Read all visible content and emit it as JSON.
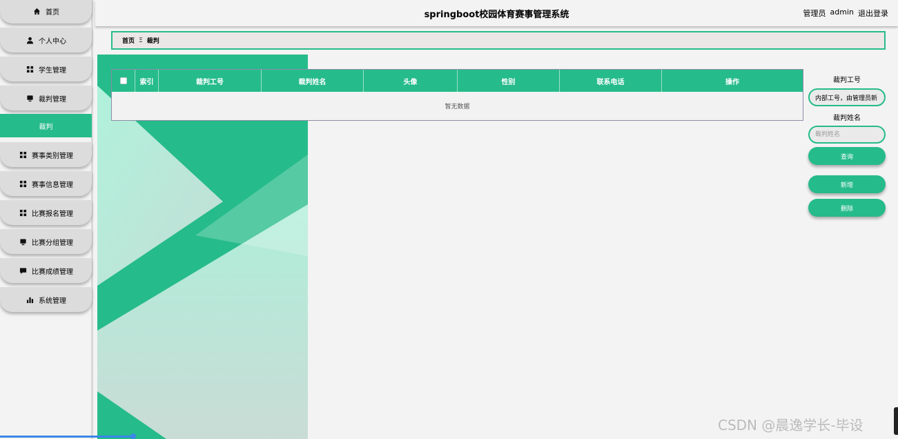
{
  "header": {
    "title": "springboot校园体育赛事管理系统",
    "role": "管理员",
    "username": "admin",
    "logout": "退出登录"
  },
  "sidebar": {
    "items": [
      {
        "label": "首页",
        "icon": "home-icon"
      },
      {
        "label": "个人中心",
        "icon": "user-icon"
      },
      {
        "label": "学生管理",
        "icon": "grid-icon"
      },
      {
        "label": "裁判管理",
        "icon": "monitor-icon"
      },
      {
        "label": "裁判",
        "icon": "",
        "active": true
      },
      {
        "label": "赛事类别管理",
        "icon": "grid-icon"
      },
      {
        "label": "赛事信息管理",
        "icon": "grid-icon"
      },
      {
        "label": "比赛报名管理",
        "icon": "grid-icon"
      },
      {
        "label": "比赛分组管理",
        "icon": "monitor-icon"
      },
      {
        "label": "比赛成绩管理",
        "icon": "message-icon"
      },
      {
        "label": "系统管理",
        "icon": "bar-chart-icon"
      }
    ]
  },
  "breadcrumb": {
    "home": "首页",
    "separator": "Ξ",
    "current": "裁判"
  },
  "table": {
    "columns": [
      "索引",
      "裁判工号",
      "裁判姓名",
      "头像",
      "性别",
      "联系电话",
      "操作"
    ],
    "empty_text": "暂无数据"
  },
  "search": {
    "field1_label": "裁判工号",
    "field1_value": "内部工号，由管理员新",
    "field2_label": "裁判姓名",
    "field2_placeholder": "裁判姓名",
    "query_button": "查询",
    "add_button": "新增",
    "delete_button": "删除"
  },
  "watermark": "CSDN @晨逸学长-毕设",
  "colors": {
    "accent": "#26bb8a",
    "accent_light": "#b3f0dc"
  }
}
